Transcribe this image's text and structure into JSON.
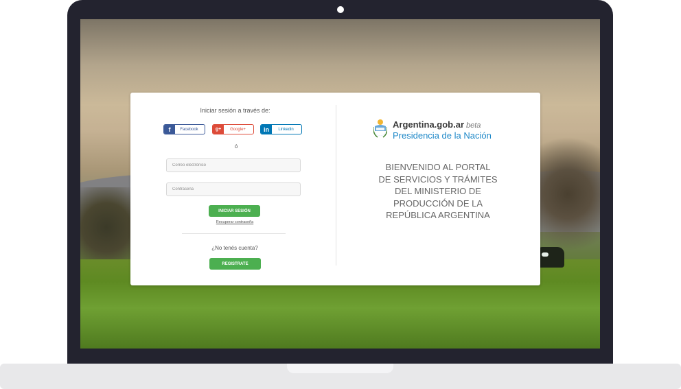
{
  "login": {
    "heading": "Iniciar sesión a través de:",
    "social": {
      "facebook": "Facebook",
      "google": "Google+",
      "linkedin": "Linkedin"
    },
    "or": "ó",
    "email_placeholder": "Correo electrónico",
    "password_placeholder": "Contraseña",
    "login_button": "INICIAR SESIÓN",
    "recover_link": "Recuperar contraseña",
    "no_account": "¿No tenés cuenta?",
    "register_button": "REGISTRATE"
  },
  "brand": {
    "name": "Argentina.gob.ar",
    "beta": "beta",
    "subtitle": "Presidencia de la Nación"
  },
  "welcome": {
    "lines": [
      "BIENVENIDO AL PORTAL",
      "DE SERVICIOS Y TRÁMITES",
      "DEL MINISTERIO DE",
      "PRODUCCIÓN DE LA",
      "REPÚBLICA ARGENTINA"
    ]
  },
  "colors": {
    "facebook": "#3b5998",
    "google": "#dd4b39",
    "linkedin": "#0077b5",
    "primary_green": "#4caf50",
    "brand_blue": "#1e88c8"
  },
  "icons": {
    "facebook": "facebook-icon",
    "google": "google-plus-icon",
    "linkedin": "linkedin-icon",
    "logo": "coat-of-arms-icon"
  }
}
